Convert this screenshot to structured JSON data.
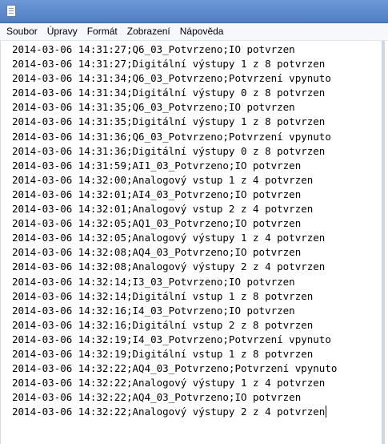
{
  "window": {
    "title": "",
    "icon": "notepad-icon"
  },
  "menu": [
    "Soubor",
    "Úpravy",
    "Formát",
    "Zobrazení",
    "Nápověda"
  ],
  "editor": {
    "lines": [
      "2014-03-06 14:31:27;Q6_03_Potvrzeno;IO potvrzen",
      "2014-03-06 14:31:27;Digitální výstupy 1 z 8 potvrzen",
      "2014-03-06 14:31:34;Q6_03_Potvrzeno;Potvrzení vpynuto",
      "2014-03-06 14:31:34;Digitální výstupy 0 z 8 potvrzen",
      "2014-03-06 14:31:35;Q6_03_Potvrzeno;IO potvrzen",
      "2014-03-06 14:31:35;Digitální výstupy 1 z 8 potvrzen",
      "2014-03-06 14:31:36;Q6_03_Potvrzeno;Potvrzení vpynuto",
      "2014-03-06 14:31:36;Digitální výstupy 0 z 8 potvrzen",
      "2014-03-06 14:31:59;AI1_03_Potvrzeno;IO potvrzen",
      "2014-03-06 14:32:00;Analogový vstup 1 z 4 potvrzen",
      "2014-03-06 14:32:01;AI4_03_Potvrzeno;IO potvrzen",
      "2014-03-06 14:32:01;Analogový vstup 2 z 4 potvrzen",
      "2014-03-06 14:32:05;AQ1_03_Potvrzeno;IO potvrzen",
      "2014-03-06 14:32:05;Analogový výstupy 1 z 4 potvrzen",
      "2014-03-06 14:32:08;AQ4_03_Potvrzeno;IO potvrzen",
      "2014-03-06 14:32:08;Analogový výstupy 2 z 4 potvrzen",
      "2014-03-06 14:32:14;I3_03_Potvrzeno;IO potvrzen",
      "2014-03-06 14:32:14;Digitální vstup 1 z 8 potvrzen",
      "2014-03-06 14:32:16;I4_03_Potvrzeno;IO potvrzen",
      "2014-03-06 14:32:16;Digitální vstup 2 z 8 potvrzen",
      "2014-03-06 14:32:19;I4_03_Potvrzeno;Potvrzení vpynuto",
      "2014-03-06 14:32:19;Digitální vstup 1 z 8 potvrzen",
      "2014-03-06 14:32:22;AQ4_03_Potvrzeno;Potvrzení vpynuto",
      "2014-03-06 14:32:22;Analogový výstupy 1 z 4 potvrzen",
      "2014-03-06 14:32:22;AQ4_03_Potvrzeno;IO potvrzen",
      "2014-03-06 14:32:22;Analogový výstupy 2 z 4 potvrzen"
    ]
  }
}
